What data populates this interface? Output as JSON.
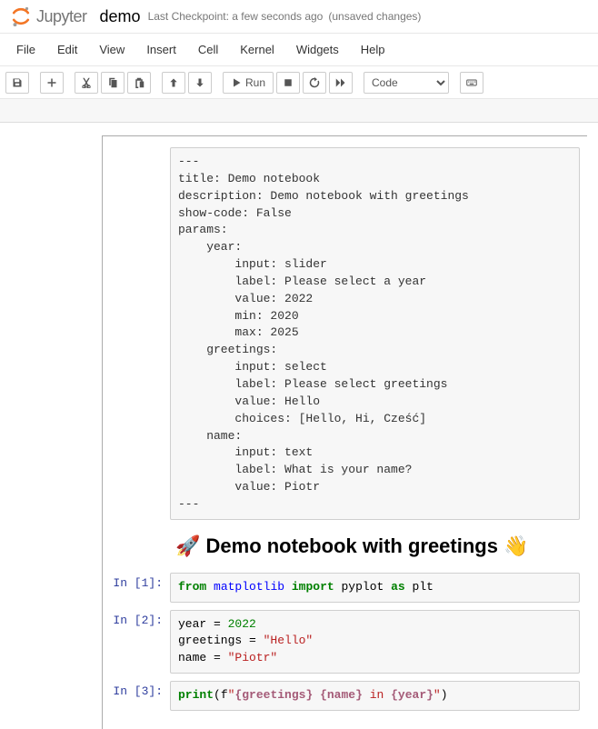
{
  "header": {
    "logo_text": "Jupyter",
    "notebook_name": "demo",
    "checkpoint": "Last Checkpoint: a few seconds ago",
    "unsaved": "(unsaved changes)"
  },
  "menu": {
    "file": "File",
    "edit": "Edit",
    "view": "View",
    "insert": "Insert",
    "cell": "Cell",
    "kernel": "Kernel",
    "widgets": "Widgets",
    "help": "Help"
  },
  "toolbar": {
    "run_label": "Run",
    "cell_type_selected": "Code"
  },
  "cells": {
    "raw0": "---\ntitle: Demo notebook\ndescription: Demo notebook with greetings\nshow-code: False\nparams:\n    year:\n        input: slider\n        label: Please select a year\n        value: 2022\n        min: 2020\n        max: 2025\n    greetings:\n        input: select\n        label: Please select greetings\n        value: Hello\n        choices: [Hello, Hi, Cześć]\n    name:\n        input: text\n        label: What is your name?\n        value: Piotr\n---",
    "md_heading": "🚀 Demo notebook with greetings 👋",
    "in1_prompt": "In [1]:",
    "in2_prompt": "In [2]:",
    "in3_prompt": "In [3]:",
    "code1": {
      "from": "from",
      "mod": "matplotlib",
      "import": "import",
      "sub": "pyplot",
      "as": "as",
      "alias": "plt"
    },
    "code2": {
      "l1_var": "year",
      "l1_eq": " = ",
      "l1_val": "2022",
      "l2_var": "greetings",
      "l2_eq": " = ",
      "l2_val": "\"Hello\"",
      "l3_var": "name",
      "l3_eq": " = ",
      "l3_val": "\"Piotr\""
    },
    "code3": {
      "fn": "print",
      "open": "(f",
      "s1": "\"",
      "i1": "{greetings}",
      "s2": " ",
      "i2": "{name}",
      "s3": " in ",
      "i3": "{year}",
      "s4": "\"",
      "close": ")"
    }
  }
}
